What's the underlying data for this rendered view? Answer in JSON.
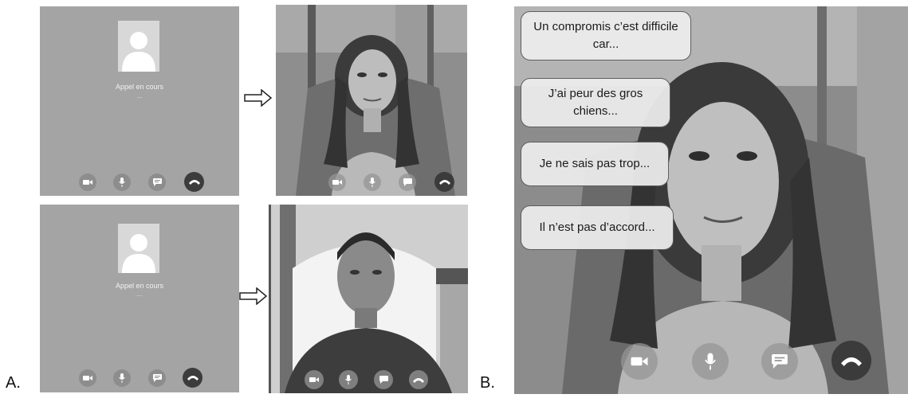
{
  "labels": {
    "a": "A.",
    "b": "B."
  },
  "call_screen": {
    "status": "Appel en cours",
    "dots": "..."
  },
  "controls": [
    {
      "name": "video-camera-icon"
    },
    {
      "name": "microphone-icon"
    },
    {
      "name": "chat-bubble-icon"
    },
    {
      "name": "hang-up-phone-icon"
    }
  ],
  "bubbles": [
    "Un compromis c’est difficile car...",
    "J’ai peur des gros chiens...",
    "Je ne sais pas trop...",
    "Il n’est pas d’accord..."
  ],
  "colors": {
    "call_screen_bg": "#a4a4a4",
    "hangup_button": "#3c3c3c",
    "control_button": "#8d8d8d"
  }
}
